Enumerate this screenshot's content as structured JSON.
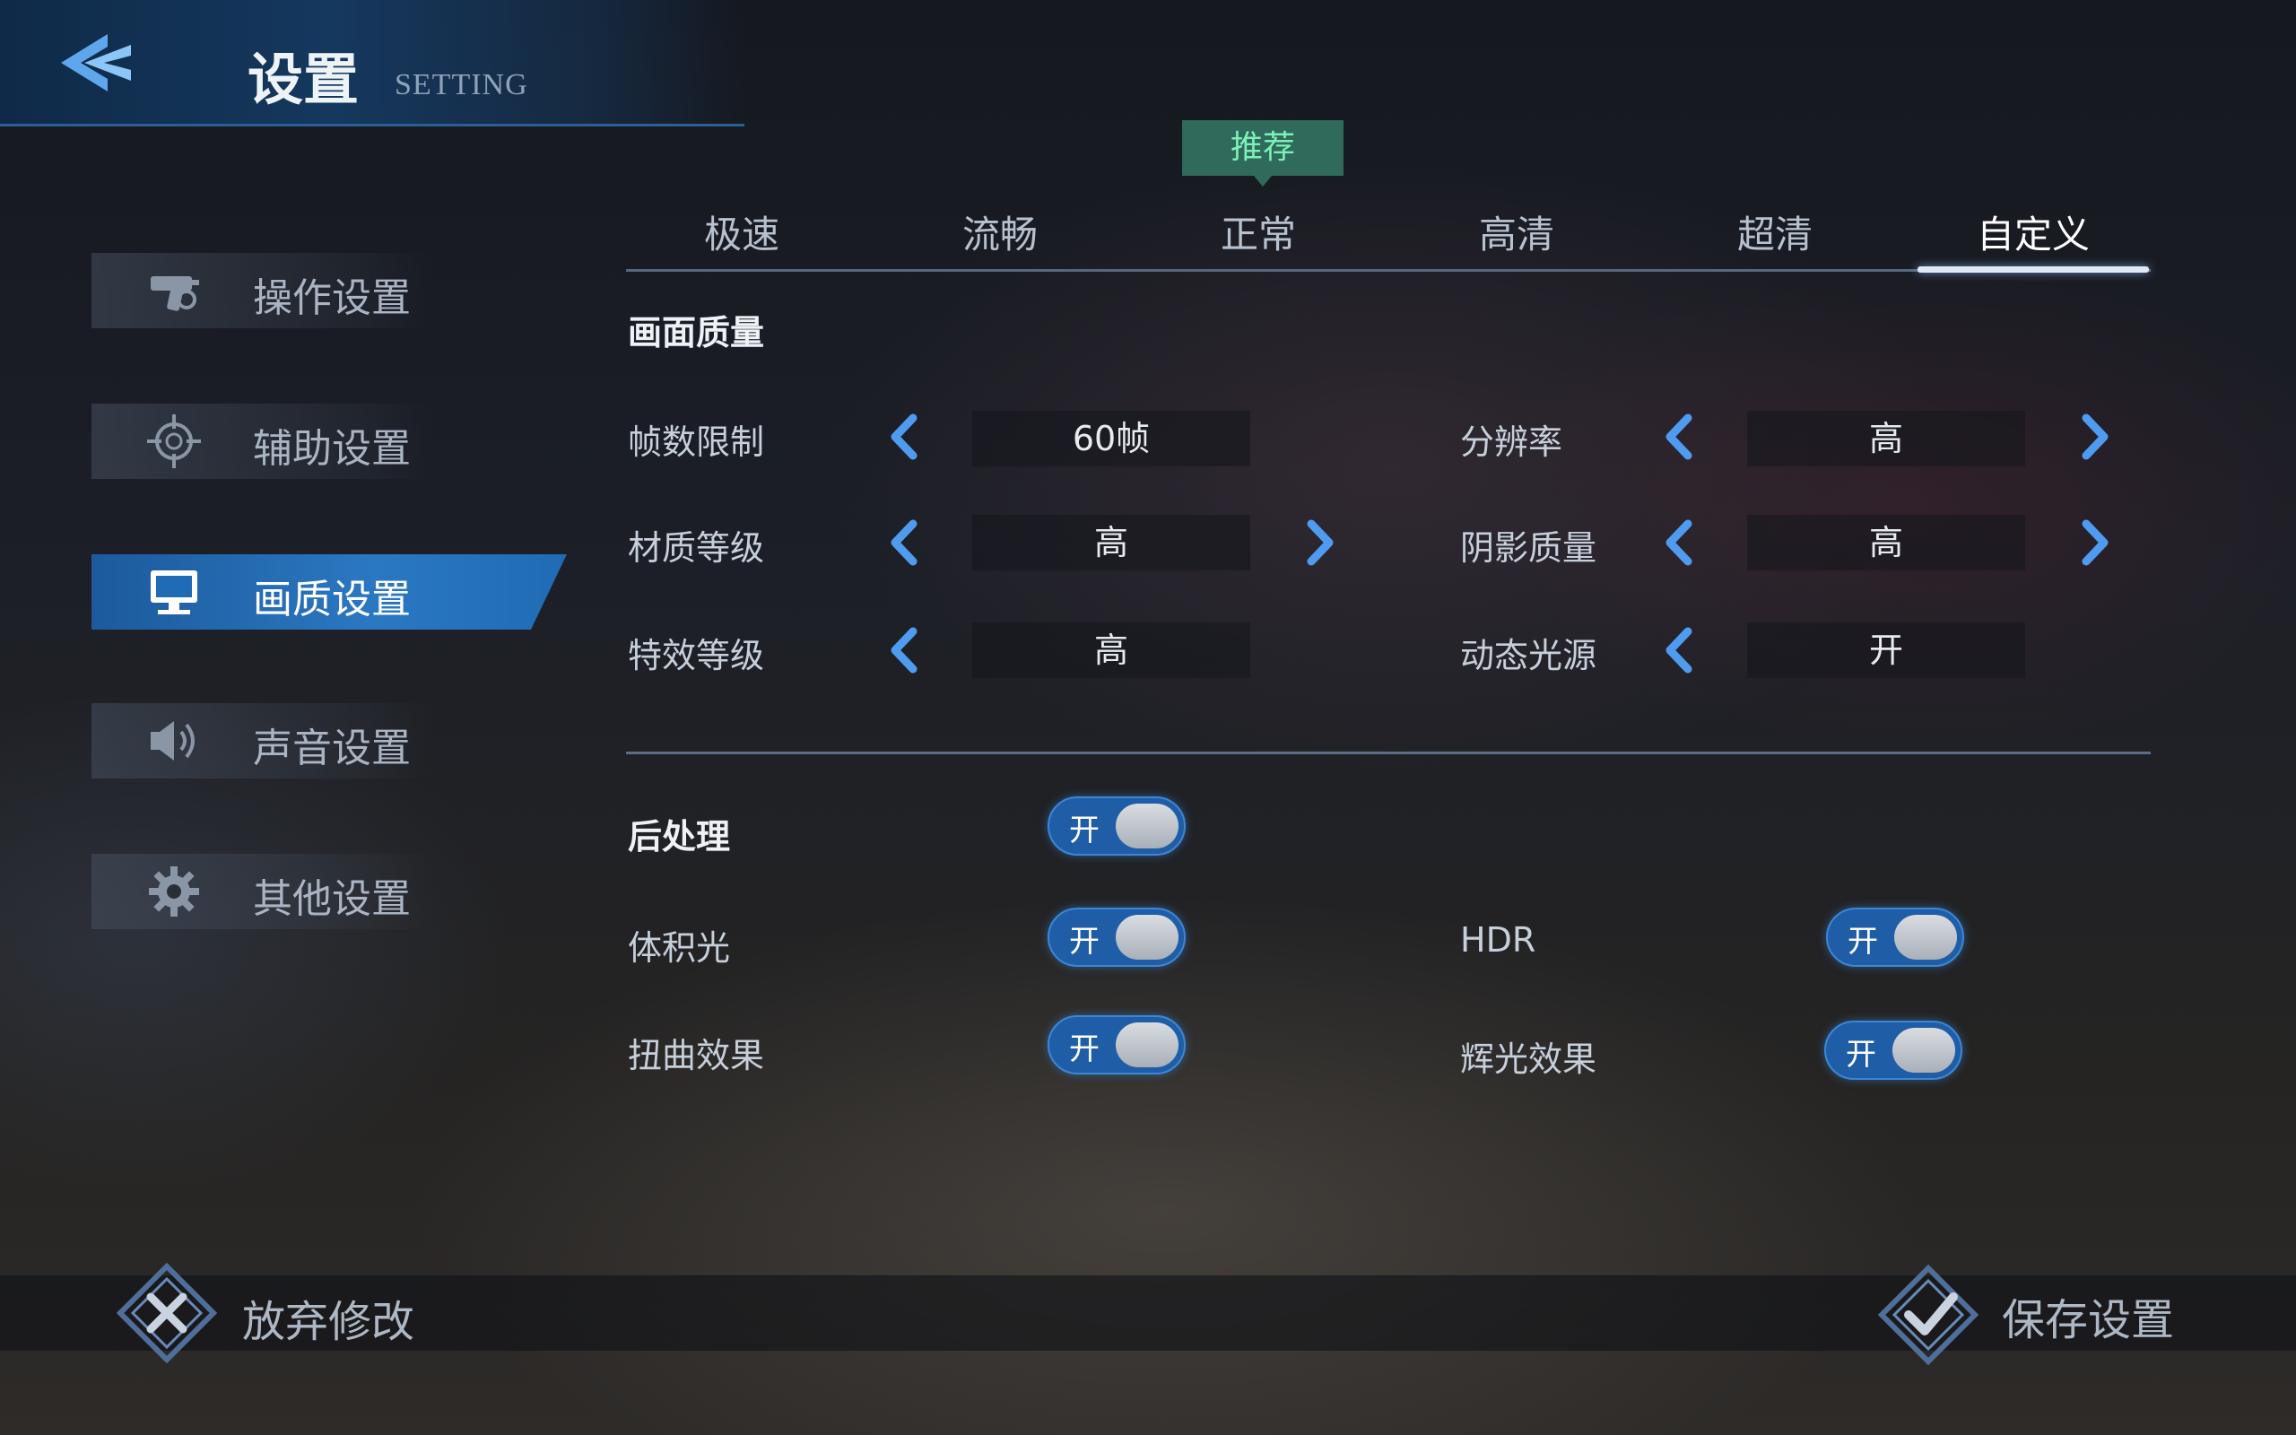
{
  "header": {
    "title": "设置",
    "subtitle": "SETTING",
    "back_icon": "back-arrow-icon"
  },
  "sidebar": {
    "items": [
      {
        "label": "操作设置",
        "icon": "gun-icon",
        "active": false
      },
      {
        "label": "辅助设置",
        "icon": "crosshair-icon",
        "active": false
      },
      {
        "label": "画质设置",
        "icon": "monitor-icon",
        "active": true
      },
      {
        "label": "声音设置",
        "icon": "speaker-icon",
        "active": false
      },
      {
        "label": "其他设置",
        "icon": "gear-icon",
        "active": false
      }
    ]
  },
  "presets": {
    "recommended_badge": "推荐",
    "tabs": [
      {
        "label": "极速",
        "active": false
      },
      {
        "label": "流畅",
        "active": false
      },
      {
        "label": "正常",
        "active": false
      },
      {
        "label": "高清",
        "active": false
      },
      {
        "label": "超清",
        "active": false
      },
      {
        "label": "自定义",
        "active": true
      }
    ]
  },
  "quality": {
    "section_title": "画面质量",
    "rows": [
      {
        "label": "帧数限制",
        "value": "60帧"
      },
      {
        "label": "材质等级",
        "value": "高"
      },
      {
        "label": "特效等级",
        "value": "高"
      },
      {
        "label": "分辨率",
        "value": "高"
      },
      {
        "label": "阴影质量",
        "value": "高"
      },
      {
        "label": "动态光源",
        "value": "开"
      }
    ]
  },
  "post": {
    "section_title": "后处理",
    "toggles": [
      {
        "label": "后处理",
        "state": "开"
      },
      {
        "label": "体积光",
        "state": "开"
      },
      {
        "label": "扭曲效果",
        "state": "开"
      },
      {
        "label": "HDR",
        "state": "开"
      },
      {
        "label": "辉光效果",
        "state": "开"
      }
    ]
  },
  "footer": {
    "discard_label": "放弃修改",
    "save_label": "保存设置"
  },
  "colors": {
    "accent": "#2b78c2",
    "badge_text": "#7df0b9",
    "toggle_on": "#1f5ea6"
  }
}
